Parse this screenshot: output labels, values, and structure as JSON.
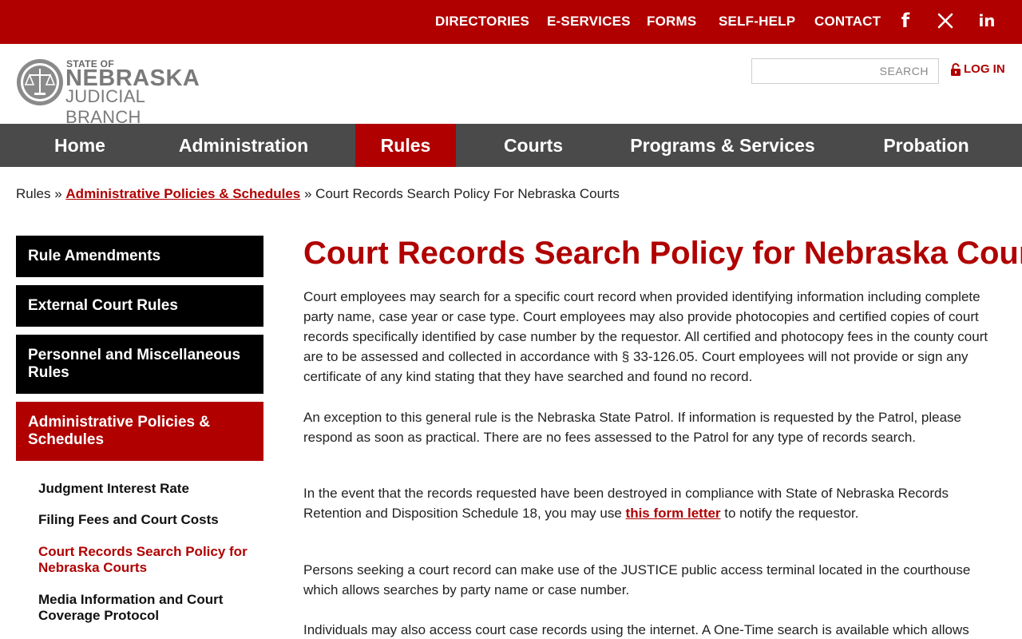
{
  "topbar": {
    "links": [
      "DIRECTORIES",
      "E-SERVICES",
      "FORMS",
      "SELF-HELP",
      "CONTACT"
    ],
    "social": [
      "facebook-icon",
      "x-icon",
      "linkedin-icon"
    ],
    "social_glyphs": [
      "f",
      "𝕏",
      "in"
    ]
  },
  "header": {
    "logo_line1": "STATE OF",
    "logo_line2": "NEBRASKA",
    "logo_line3": "JUDICIAL BRANCH",
    "search_placeholder": "SEARCH",
    "login_label": "LOG IN"
  },
  "mainnav": {
    "items": [
      "Home",
      "Administration",
      "Rules",
      "Courts",
      "Programs & Services",
      "Probation"
    ],
    "active": "Rules"
  },
  "breadcrumb": {
    "root": "Rules",
    "sep1": "»",
    "link": "Administrative Policies & Schedules",
    "sep2": "»",
    "current": "Court Records Search Policy For Nebraska Courts"
  },
  "sidebar": {
    "buttons": [
      "Rule Amendments",
      "External Court Rules",
      "Personnel and Miscellaneous Rules",
      "Administrative Policies & Schedules"
    ],
    "subitems": [
      "Judgment Interest Rate",
      "Filing Fees and Court Costs",
      "Court Records Search Policy for Nebraska Courts",
      "Media Information and Court Coverage Protocol"
    ]
  },
  "content": {
    "title": "Court Records Search Policy for Nebraska Courts",
    "p1": "Court employees may search for a specific court record when provided identifying information including complete party name, case year or case type.  Court employees may also provide photocopies and certified copies of court records specifically identified by case number by the requestor. All certified and photocopy fees in the county court are to be assessed and collected in accordance with § 33-126.05. Court employees will not provide or sign any certificate of any kind stating that they have searched and found no record.",
    "p2": "An exception to this general rule is the Nebraska State Patrol. If information is requested by the Patrol, please respond as soon as practical. There are no fees assessed to the Patrol for any type of records search.",
    "p3_before": "In the event that the records requested have been destroyed in compliance with State of Nebraska Records Retention and Disposition Schedule 18, you may use ",
    "p3_link": "this form letter",
    "p3_after": " to notify the requestor.",
    "p4": "Persons seeking a court record can make use of the JUSTICE public access terminal located in the courthouse which allows searches by party name or case number.",
    "p5": "Individuals may also access court case records using the internet.  A One-Time search is available which allows access"
  },
  "colors": {
    "brand_red": "#b00000",
    "nav_gray": "#4a4a4a",
    "sidebar_black": "#000000"
  }
}
